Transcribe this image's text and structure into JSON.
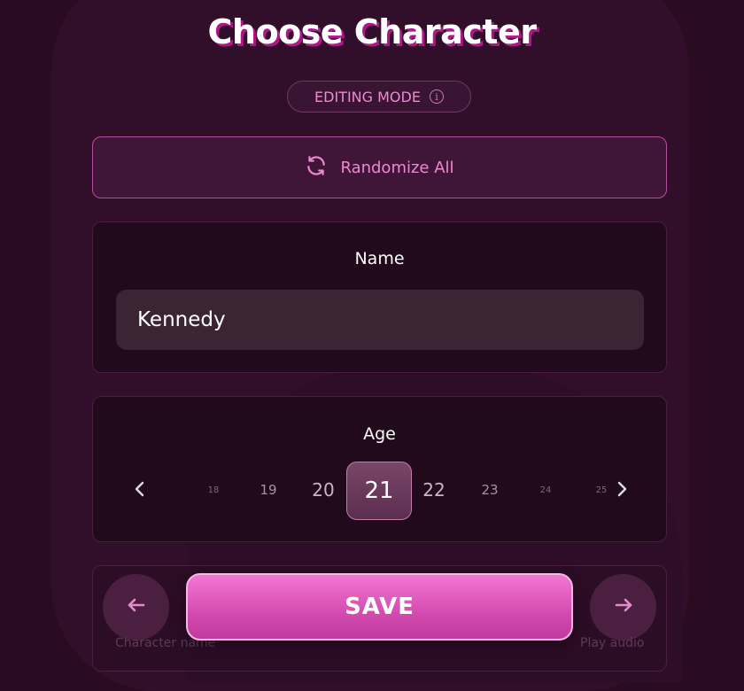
{
  "header": {
    "title": "Choose Character"
  },
  "mode_pill": {
    "label": "EDITING MODE",
    "icon": "info-icon"
  },
  "randomize": {
    "label": "Randomize All",
    "icon": "refresh-icon"
  },
  "name_panel": {
    "title": "Name",
    "value": "Kennedy"
  },
  "age_panel": {
    "title": "Age",
    "options": [
      "18",
      "19",
      "20",
      "21",
      "22",
      "23",
      "24",
      "25"
    ],
    "selected": "21"
  },
  "footer": {
    "save_label": "SAVE",
    "prev_label": "Character name",
    "next_label": "Play audio"
  },
  "colors": {
    "accent": "#e06cc4",
    "background": "#2a0c22",
    "save_gradient_top": "#f277d3",
    "save_gradient_bottom": "#c03a9c"
  }
}
